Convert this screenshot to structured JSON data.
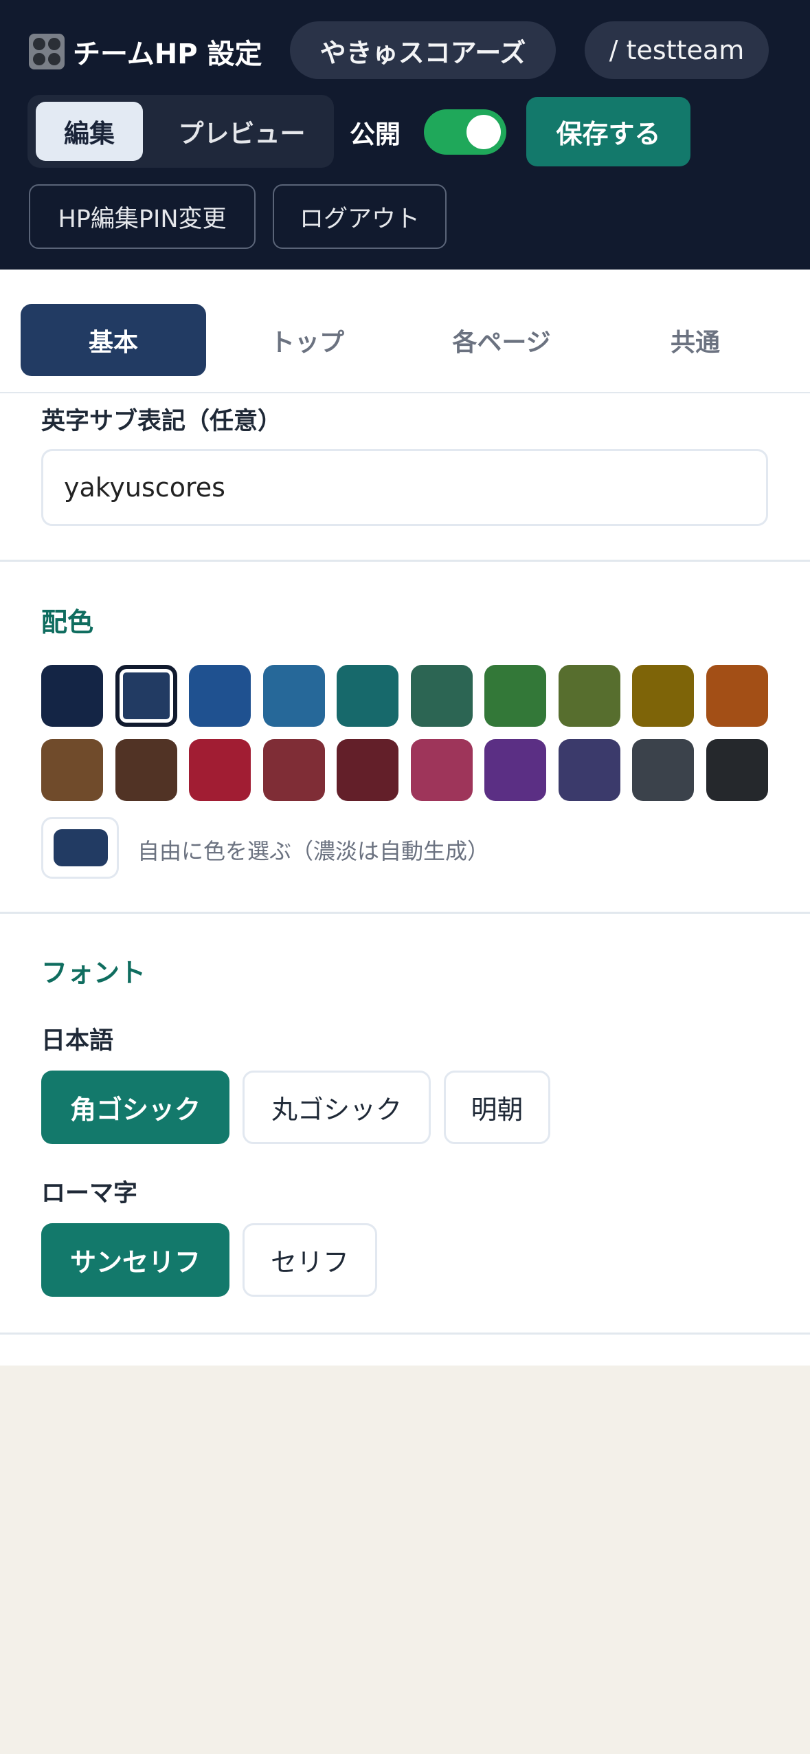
{
  "header": {
    "title": "チームHP 設定",
    "team_name": "やきゅスコアーズ",
    "slug": "/ testteam",
    "mode_tabs": [
      "編集",
      "プレビュー"
    ],
    "public_label": "公開",
    "public_enabled": true,
    "save_label": "保存する",
    "pin_label": "HP編集PIN変更",
    "logout_label": "ログアウト"
  },
  "tabs": [
    "基本",
    "トップ",
    "各ページ",
    "共通"
  ],
  "active_tab": "基本",
  "subtitle_field": {
    "label": "英字サブ表記（任意）",
    "value": "yakyuscores"
  },
  "colors": {
    "title": "配色",
    "palette_row1": [
      "#142545",
      "#223b63",
      "#1f5190",
      "#266899",
      "#17696b",
      "#2c6553",
      "#337838",
      "#576e2e",
      "#7e6408",
      "#a34f16"
    ],
    "palette_row2": [
      "#704b2b",
      "#513325",
      "#a11d33",
      "#7f2d36",
      "#631f29",
      "#9e355a",
      "#5b2f84",
      "#3b3a6b",
      "#3b424b",
      "#25282c"
    ],
    "selected": "#223b63",
    "custom_label": "自由に色を選ぶ（濃淡は自動生成）"
  },
  "font": {
    "title": "フォント",
    "japanese_label": "日本語",
    "japanese_options": [
      "角ゴシック",
      "丸ゴシック",
      "明朝"
    ],
    "japanese_selected": "角ゴシック",
    "roman_label": "ローマ字",
    "roman_options": [
      "サンセリフ",
      "セリフ"
    ],
    "roman_selected": "サンセリフ"
  },
  "accent_color": "#13796b",
  "header_bg": "#111a2e"
}
